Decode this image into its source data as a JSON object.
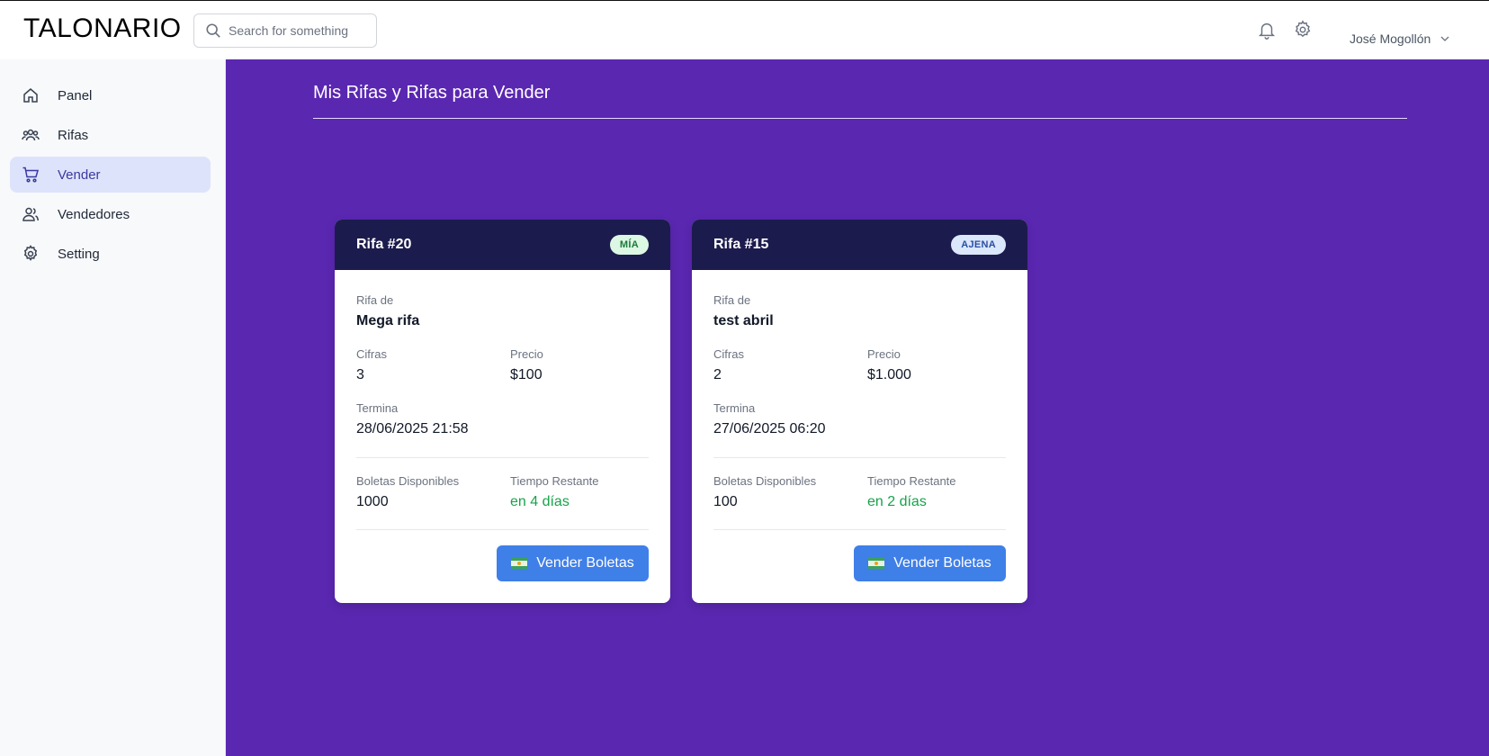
{
  "header": {
    "logo": "TALONARIO",
    "search_placeholder": "Search for something",
    "user_name": "José Mogollón"
  },
  "sidebar": {
    "items": [
      {
        "label": "Panel",
        "icon": "home-icon"
      },
      {
        "label": "Rifas",
        "icon": "users-group-icon"
      },
      {
        "label": "Vender",
        "icon": "cart-icon",
        "active": true
      },
      {
        "label": "Vendedores",
        "icon": "users-icon"
      },
      {
        "label": "Setting",
        "icon": "gear-icon"
      }
    ]
  },
  "main": {
    "title": "Mis Rifas y Rifas para Vender",
    "cards": [
      {
        "title": "Rifa #20",
        "badge": "MÍA",
        "rifa_de_label": "Rifa de",
        "rifa_de": "Mega rifa",
        "cifras_label": "Cifras",
        "cifras": "3",
        "precio_label": "Precio",
        "precio": "$100",
        "termina_label": "Termina",
        "termina": "28/06/2025 21:58",
        "boletas_label": "Boletas Disponibles",
        "boletas": "1000",
        "tiempo_label": "Tiempo Restante",
        "tiempo": "en 4 días",
        "button": "Vender Boletas"
      },
      {
        "title": "Rifa #15",
        "badge": "AJENA",
        "rifa_de_label": "Rifa de",
        "rifa_de": "test abril",
        "cifras_label": "Cifras",
        "cifras": "2",
        "precio_label": "Precio",
        "precio": "$1.000",
        "termina_label": "Termina",
        "termina": "27/06/2025 06:20",
        "boletas_label": "Boletas Disponibles",
        "boletas": "100",
        "tiempo_label": "Tiempo Restante",
        "tiempo": "en 2 días",
        "button": "Vender Boletas"
      }
    ]
  },
  "colors": {
    "main_bg": "#5a27b1",
    "card_header": "#1c1b4d",
    "button": "#3f7fe8",
    "active_nav": "#dde3fb",
    "remaining_time": "#16a34a"
  }
}
